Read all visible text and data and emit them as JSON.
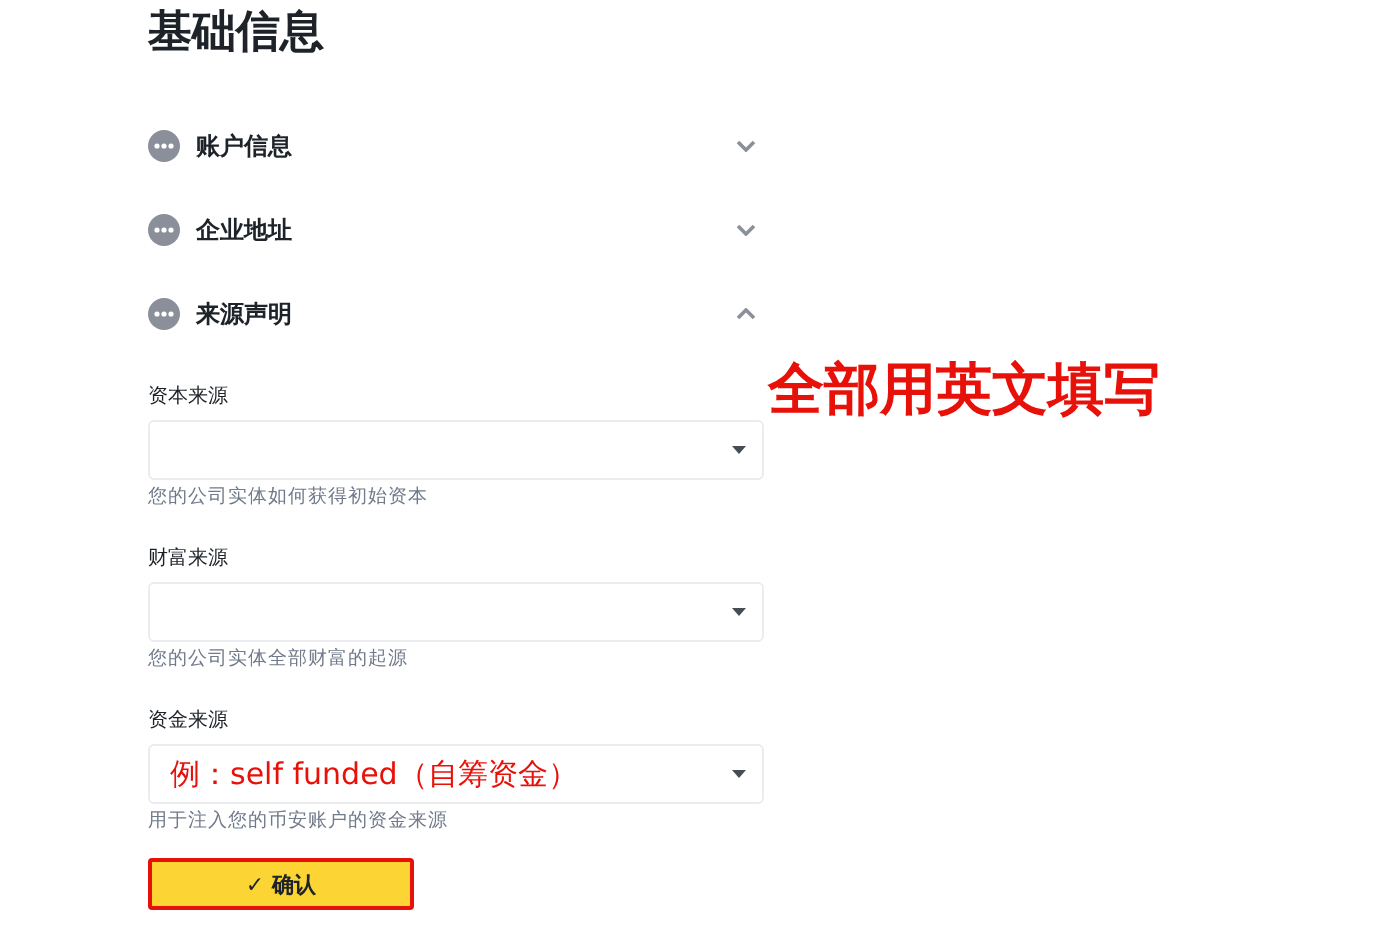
{
  "title": "基础信息",
  "sections": [
    {
      "label": "账户信息",
      "expanded": false
    },
    {
      "label": "企业地址",
      "expanded": false
    },
    {
      "label": "来源声明",
      "expanded": true
    }
  ],
  "annotation": "全部用英文填写",
  "fields": [
    {
      "label": "资本来源",
      "hint": "您的公司实体如何获得初始资本"
    },
    {
      "label": "财富来源",
      "hint": "您的公司实体全部财富的起源"
    },
    {
      "label": "资金来源",
      "value": "例：self funded（自筹资金）",
      "hint": "用于注入您的币安账户的资金来源"
    }
  ],
  "confirm_button": {
    "icon": "✓",
    "label": "确认",
    "highlighted": true
  }
}
